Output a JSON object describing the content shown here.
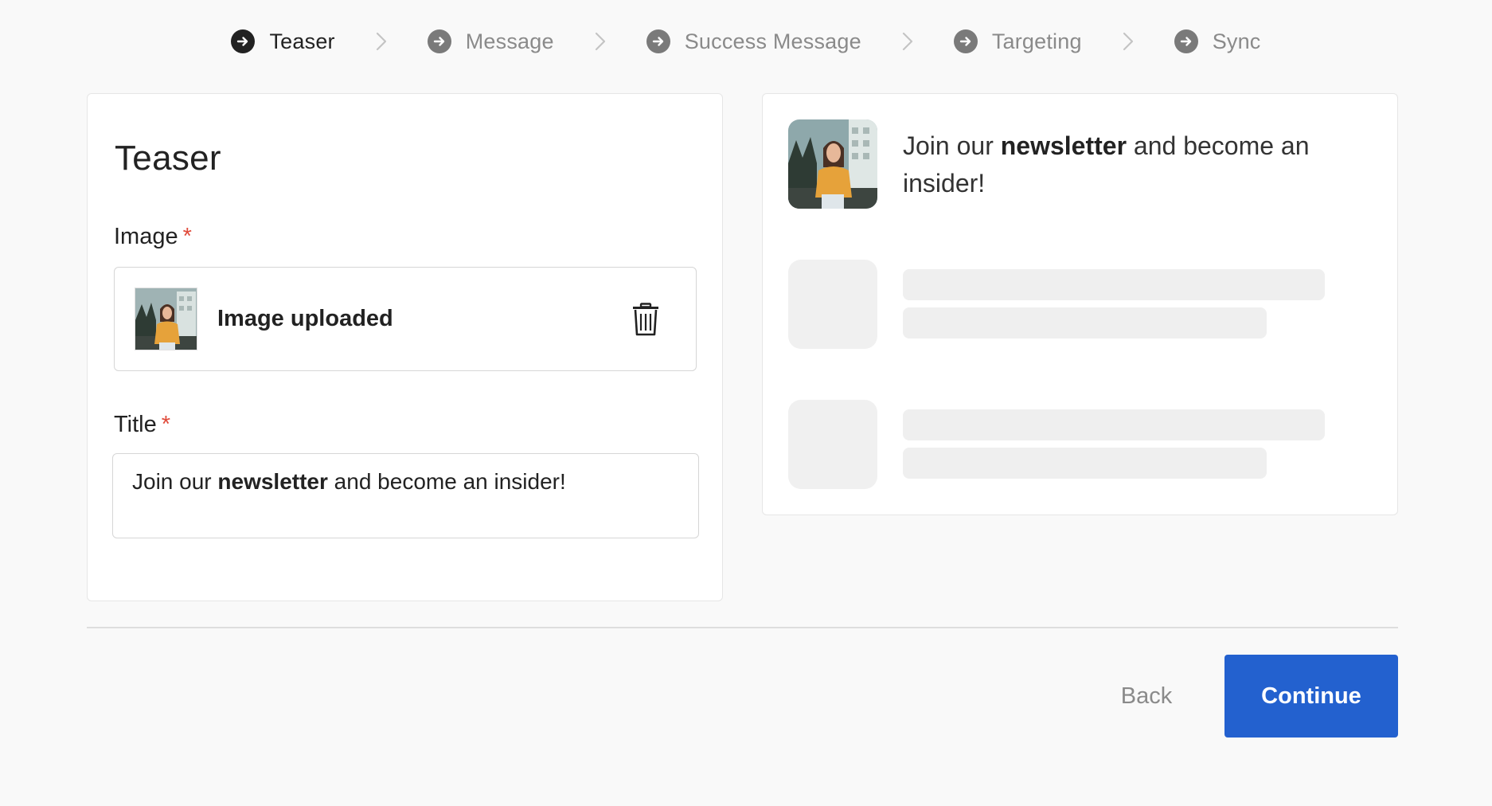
{
  "stepper": {
    "steps": [
      {
        "label": "Teaser",
        "active": true
      },
      {
        "label": "Message",
        "active": false
      },
      {
        "label": "Success Message",
        "active": false
      },
      {
        "label": "Targeting",
        "active": false
      },
      {
        "label": "Sync",
        "active": false
      }
    ],
    "separator_icon": "chevron-right-icon",
    "step_icon": "arrow-right-circle-icon"
  },
  "form": {
    "title": "Teaser",
    "image_label": "Image",
    "required_mark": "*",
    "upload_status": "Image uploaded",
    "delete_icon": "trash-icon",
    "title_label": "Title",
    "title_value": {
      "before": "Join our ",
      "bold": "newsletter",
      "after": " and become an insider!"
    }
  },
  "preview": {
    "text_before": "Join our ",
    "text_bold": "newsletter",
    "text_after": " and become an insider!"
  },
  "footer": {
    "back_label": "Back",
    "continue_label": "Continue"
  },
  "colors": {
    "primary": "#2361cf",
    "required": "#e04a3a",
    "background": "#f9f9f9"
  }
}
